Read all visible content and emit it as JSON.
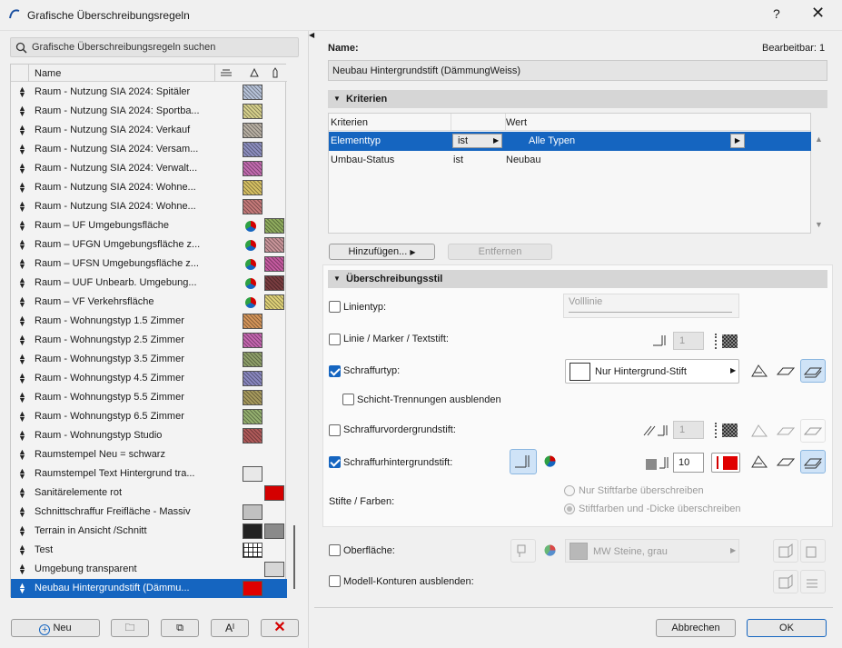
{
  "window": {
    "title": "Grafische Überschreibungsregeln",
    "help": "?",
    "close": "✕"
  },
  "search": {
    "placeholder": "Grafische Überschreibungsregeln suchen"
  },
  "list": {
    "header": "Name",
    "rows": [
      {
        "name": "Raum - Nutzung SIA 2024: Spitäler",
        "c": "#b7c3d9"
      },
      {
        "name": "Raum - Nutzung SIA 2024: Sportba...",
        "c": "#d6d08c"
      },
      {
        "name": "Raum - Nutzung SIA 2024: Verkauf",
        "c": "#b8b0a4"
      },
      {
        "name": "Raum - Nutzung SIA 2024: Versam...",
        "c": "#8d8fc0"
      },
      {
        "name": "Raum - Nutzung SIA 2024: Verwalt...",
        "c": "#c36bb0"
      },
      {
        "name": "Raum - Nutzung SIA 2024: Wohne...",
        "c": "#d6c064"
      },
      {
        "name": "Raum - Nutzung SIA 2024: Wohne...",
        "c": "#c57a7a"
      },
      {
        "name": "Raum – UF Umgebungsfläche",
        "c": "#8fac5e",
        "p": 1
      },
      {
        "name": "Raum – UFGN Umgebungsfläche z...",
        "c": "#c9959a",
        "p": 1
      },
      {
        "name": "Raum – UFSN Umgebungsfläche z...",
        "c": "#c55aa0",
        "p": 1
      },
      {
        "name": "Raum – UUF Unbearb. Umgebung...",
        "c": "#7a3d40",
        "p": 1
      },
      {
        "name": "Raum – VF Verkehrsfläche",
        "c": "#ded178",
        "p": 1
      },
      {
        "name": "Raum - Wohnungstyp 1.5 Zimmer",
        "c": "#d4955a"
      },
      {
        "name": "Raum - Wohnungstyp 2.5 Zimmer",
        "c": "#c566b0"
      },
      {
        "name": "Raum - Wohnungstyp 3.5 Zimmer",
        "c": "#8fa06a"
      },
      {
        "name": "Raum - Wohnungstyp 4.5 Zimmer",
        "c": "#8a88c0"
      },
      {
        "name": "Raum - Wohnungstyp 5.5 Zimmer",
        "c": "#a79a5e"
      },
      {
        "name": "Raum - Wohnungstyp 6.5 Zimmer",
        "c": "#95b070"
      },
      {
        "name": "Raum - Wohnungstyp Studio",
        "c": "#b05a5a"
      },
      {
        "name": "Raumstempel Neu = schwarz",
        "c": ""
      },
      {
        "name": "Raumstempel Text Hintergrund tra...",
        "c": "#e8e8e8"
      },
      {
        "name": "Sanitärelemente rot",
        "c": "#d40000",
        "p": 2
      },
      {
        "name": "Schnittschraffur Freifläche - Massiv",
        "c": "#c0c0c0"
      },
      {
        "name": "Terrain in Ansicht /Schnitt",
        "c": "#222222",
        "c2": "#8a8a8a"
      },
      {
        "name": "Test",
        "c": "grid"
      },
      {
        "name": "Umgebung transparent",
        "c": "#d6d6d6",
        "p": 2
      },
      {
        "name": "Neubau Hintergrundstift (Dämmu...",
        "c": "#e00000",
        "sel": 1
      }
    ]
  },
  "buttons": {
    "new": "Neu",
    "cancel": "Abbrechen",
    "ok": "OK",
    "add": "Hinzufügen...",
    "remove": "Entfernen"
  },
  "detail": {
    "name_label": "Name:",
    "editable": "Bearbeitbar: 1",
    "name_value": "Neubau Hintergrundstift (DämmungWeiss)",
    "criteria_title": "Kriterien",
    "col_criteria": "Kriterien",
    "col_value": "Wert",
    "crit_rows": [
      {
        "k": "Elementtyp",
        "op": "ist",
        "v": "Alle Typen"
      },
      {
        "k": "Umbau-Status",
        "op": "ist",
        "v": "Neubau"
      }
    ],
    "style_title": "Überschreibungsstil",
    "linetype": "Linientyp:",
    "linetype_val": "Volllinie",
    "pen": "Linie / Marker / Textstift:",
    "pen_val": "1",
    "fill": "Schraffurtyp:",
    "fill_val": "Nur Hintergrund-Stift",
    "layers": "Schicht-Trennungen ausblenden",
    "fg": "Schraffurvordergrundstift:",
    "fg_val": "1",
    "bg": "Schraffurhintergrundstift:",
    "bg_val": "10",
    "pens": "Stifte / Farben:",
    "r1": "Nur Stiftfarbe überschreiben",
    "r2": "Stiftfarben und -Dicke überschreiben",
    "surface": "Oberfläche:",
    "surface_val": "MW Steine, grau",
    "contours": "Modell-Konturen ausblenden:"
  }
}
